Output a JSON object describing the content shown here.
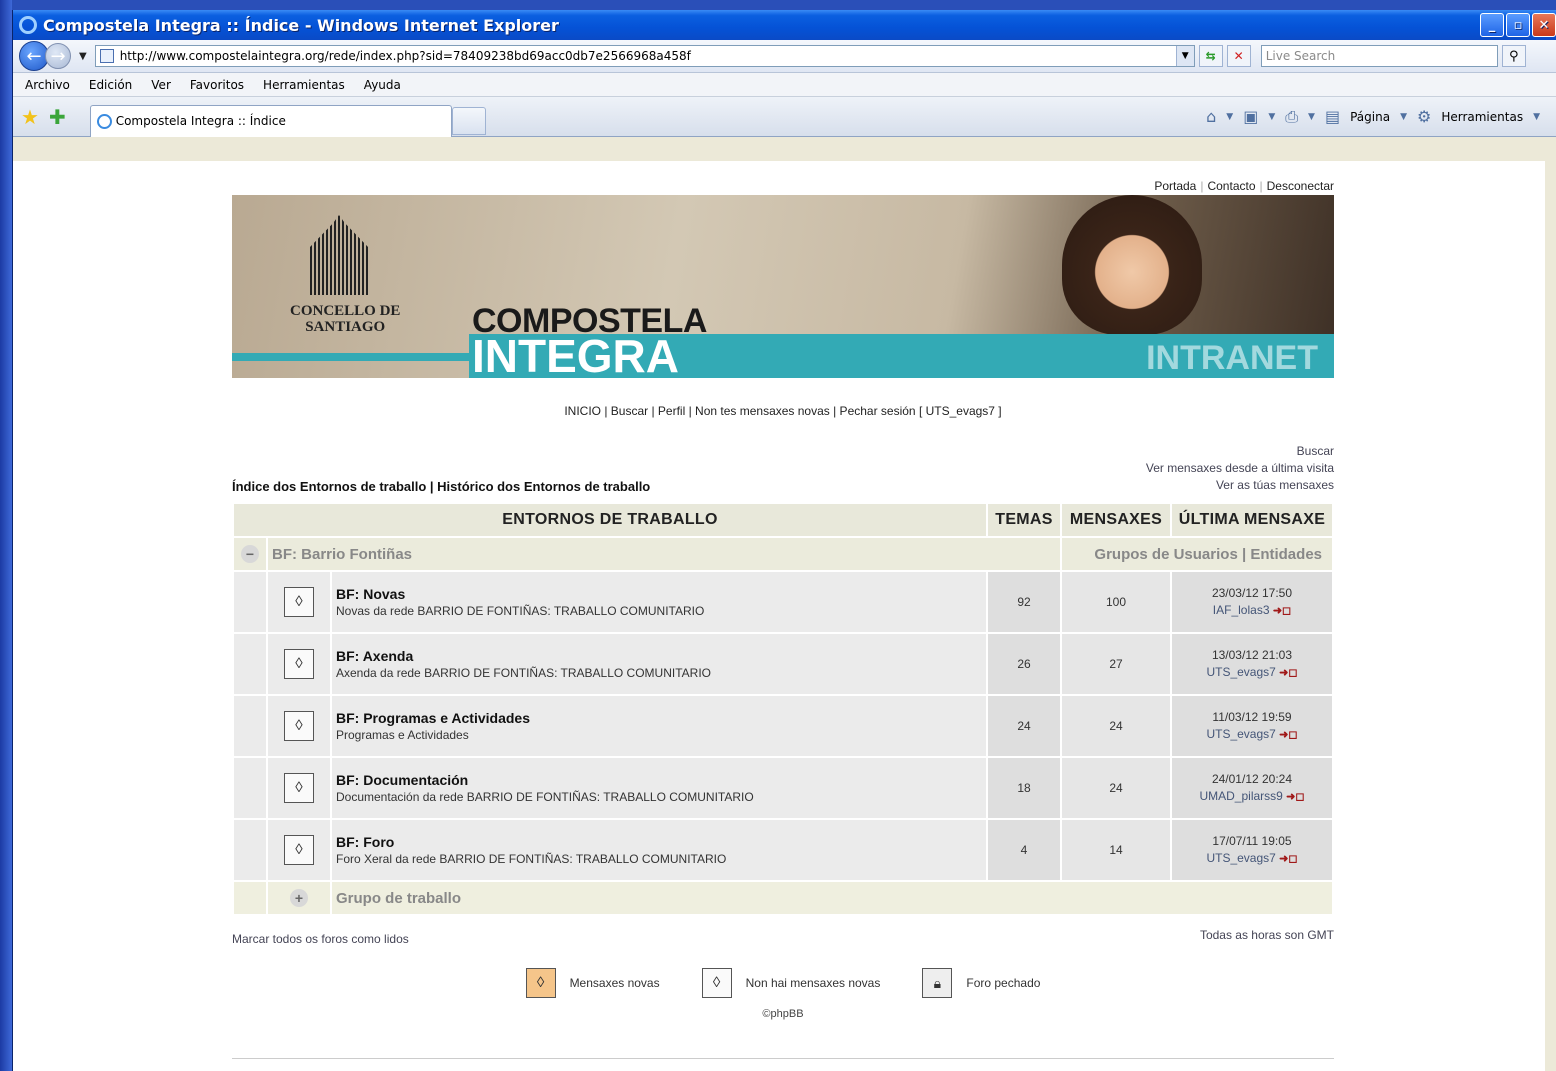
{
  "window": {
    "title": "Compostela Integra :: Índice - Windows Internet Explorer",
    "minimize": "_",
    "maximize": "▫",
    "close": "✕"
  },
  "address": {
    "url": "http://www.compostelaintegra.org/rede/index.php?sid=78409238bd69acc0db7e2566968a458f",
    "search_placeholder": "Live Search"
  },
  "menu": [
    "Archivo",
    "Edición",
    "Ver",
    "Favoritos",
    "Herramientas",
    "Ayuda"
  ],
  "tab": {
    "title": "Compostela Integra :: Índice"
  },
  "commandbar": {
    "page_label": "Página",
    "tools_label": "Herramientas"
  },
  "page": {
    "toplinks": [
      "Portada",
      "Contacto",
      "Desconectar"
    ],
    "banner": {
      "concello": "CONCELLO DE\nSANTIAGO",
      "compostela": "COMPOSTELA",
      "integra": "INTEGRA",
      "intranet": "INTRANET"
    },
    "navlinks": "INICIO | Buscar | Perfil | Non tes mensaxes novas | Pechar sesión [ UTS_evags7 ]",
    "breadcrumb": "Índice dos Entornos de traballo | Histórico dos Entornos de traballo",
    "search_links": [
      "Buscar",
      "Ver mensaxes desde a última visita",
      "Ver as túas mensaxes"
    ],
    "table": {
      "headers": [
        "ENTORNOS DE TRABALLO",
        "TEMAS",
        "MENSAXES",
        "ÚLTIMA MENSAXE"
      ],
      "category": {
        "name": "BF: Barrio Fontiñas",
        "links": "Grupos de Usuarios | Entidades",
        "toggle": "−"
      },
      "forums": [
        {
          "name": "BF: Novas",
          "desc": "Novas da rede BARRIO DE FONTIÑAS: TRABALLO COMUNITARIO",
          "temas": "92",
          "mensaxes": "100",
          "date": "23/03/12 17:50",
          "user": "IAF_lolas3"
        },
        {
          "name": "BF: Axenda",
          "desc": "Axenda da rede BARRIO DE FONTIÑAS: TRABALLO COMUNITARIO",
          "temas": "26",
          "mensaxes": "27",
          "date": "13/03/12 21:03",
          "user": "UTS_evags7"
        },
        {
          "name": "BF: Programas e Actividades",
          "desc": "Programas e Actividades",
          "temas": "24",
          "mensaxes": "24",
          "date": "11/03/12 19:59",
          "user": "UTS_evags7"
        },
        {
          "name": "BF: Documentación",
          "desc": "Documentación da rede BARRIO DE FONTIÑAS: TRABALLO COMUNITARIO",
          "temas": "18",
          "mensaxes": "24",
          "date": "24/01/12 20:24",
          "user": "UMAD_pilarss9"
        },
        {
          "name": "BF: Foro",
          "desc": "Foro Xeral da rede BARRIO DE FONTIÑAS: TRABALLO COMUNITARIO",
          "temas": "4",
          "mensaxes": "14",
          "date": "17/07/11 19:05",
          "user": "UTS_evags7"
        }
      ],
      "group": {
        "name": "Grupo de traballo",
        "toggle": "+"
      }
    },
    "mark_read": "Marcar todos os foros como lidos",
    "timezone": "Todas as horas son GMT",
    "legend": [
      "Mensaxes novas",
      "Non hai mensaxes novas",
      "Foro pechado"
    ],
    "copyright": "©phpBB"
  }
}
